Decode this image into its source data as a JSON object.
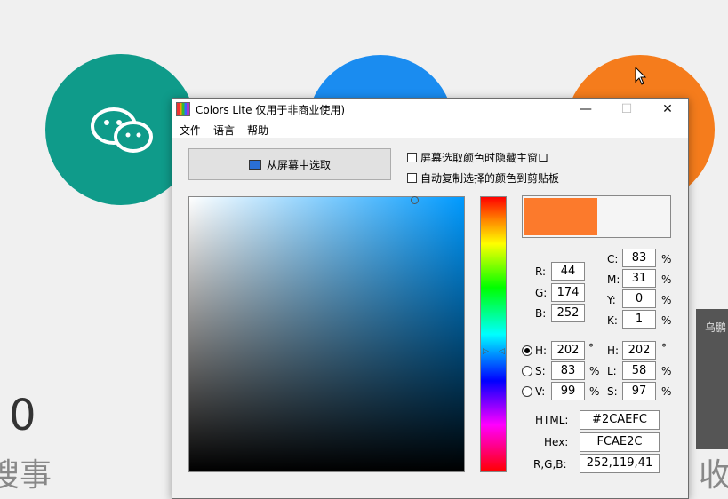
{
  "window": {
    "title": "Colors Lite 仅用于非商业使用)",
    "minimize": "—",
    "maximize": "☐",
    "close": "✕"
  },
  "menu": [
    "文件",
    "语言",
    "帮助"
  ],
  "pick_button": "从屏幕中选取",
  "options": [
    "屏幕选取颜色时隐藏主窗口",
    "自动复制选择的颜色到剪贴板"
  ],
  "swatch_color": "#FC7A2C",
  "rgb": {
    "r_label": "R:",
    "g_label": "G:",
    "b_label": "B:",
    "r": "44",
    "g": "174",
    "b": "252"
  },
  "cmyk": {
    "c_label": "C:",
    "m_label": "M:",
    "y_label": "Y:",
    "k_label": "K:",
    "c": "83",
    "m": "31",
    "y": "0",
    "k": "1",
    "unit": "%"
  },
  "hsv": {
    "h_label": "H:",
    "s_label": "S:",
    "v_label": "V:",
    "h": "202",
    "s": "83",
    "v": "99",
    "deg": "°",
    "pct": "%"
  },
  "hsl": {
    "h_label": "H:",
    "l_label": "L:",
    "s_label": "S:",
    "h": "202",
    "l": "58",
    "s": "97",
    "deg": "°",
    "pct": "%"
  },
  "codes": {
    "html_label": "HTML:",
    "html": "#2CAEFC",
    "hex_label": "Hex:",
    "hex": "FCAE2C",
    "rgb_label": "R,G,B:",
    "rgb": "252,119,41"
  },
  "background": {
    "number": "0",
    "text_left": "搜事",
    "text_right": "收",
    "panel_label": "乌鹏"
  },
  "colors": {
    "teal": "#0f9b8a",
    "blue": "#1a8cf0",
    "orange": "#f57c1c"
  }
}
